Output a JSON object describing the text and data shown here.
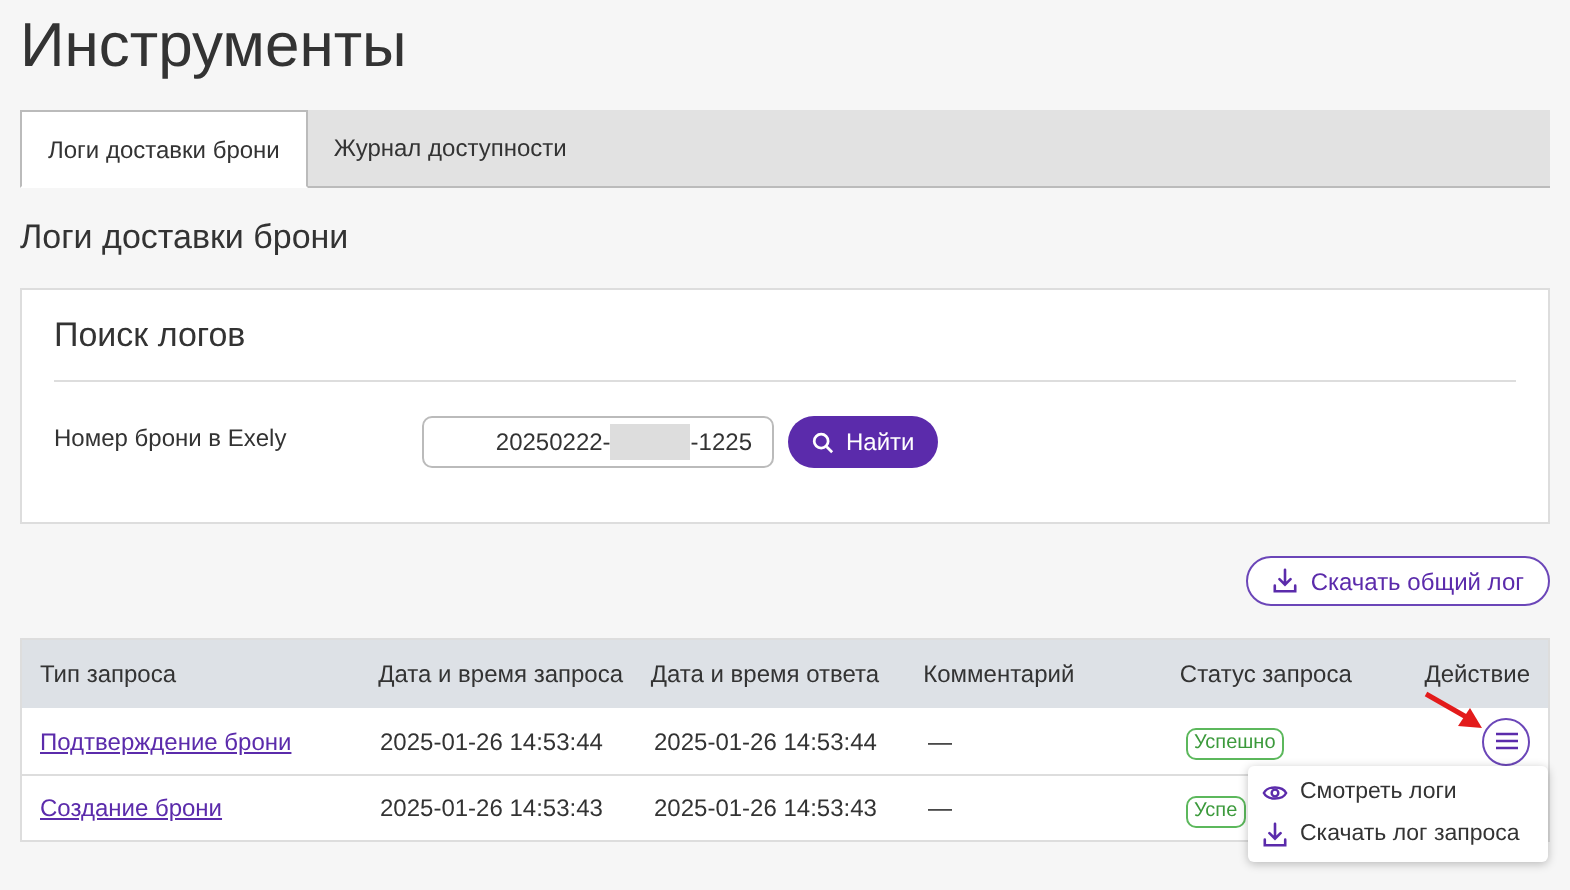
{
  "title": "Инструменты",
  "tabs": [
    {
      "label": "Логи доставки брони",
      "selected": true
    },
    {
      "label": "Журнал доступности",
      "selected": false
    }
  ],
  "section_title": "Логи доставки брони",
  "search": {
    "title": "Поиск логов",
    "label": "Номер брони в Exely",
    "value_start": "20250222-",
    "redacted": true,
    "value_end": "-1225",
    "button": "Найти"
  },
  "download_all": "Скачать общий лог",
  "table": {
    "columns": [
      "Тип запроса",
      "Дата и время запроса",
      "Дата и время ответа",
      "Комментарий",
      "Статус запроса",
      "Действие"
    ],
    "rows": [
      {
        "type": "Подтверждение брони",
        "requested": "2025-01-26 14:53:44",
        "responded": "2025-01-26 14:53:44",
        "comment": "—",
        "status": "Успешно",
        "menu_open": true
      },
      {
        "type": "Создание брони",
        "requested": "2025-01-26 14:53:43",
        "responded": "2025-01-26 14:53:43",
        "comment": "—",
        "status": "Успе"
      }
    ]
  },
  "action_menu": [
    {
      "kind": "view",
      "label": "Смотреть логи"
    },
    {
      "kind": "download",
      "label": "Скачать лог запроса"
    }
  ]
}
